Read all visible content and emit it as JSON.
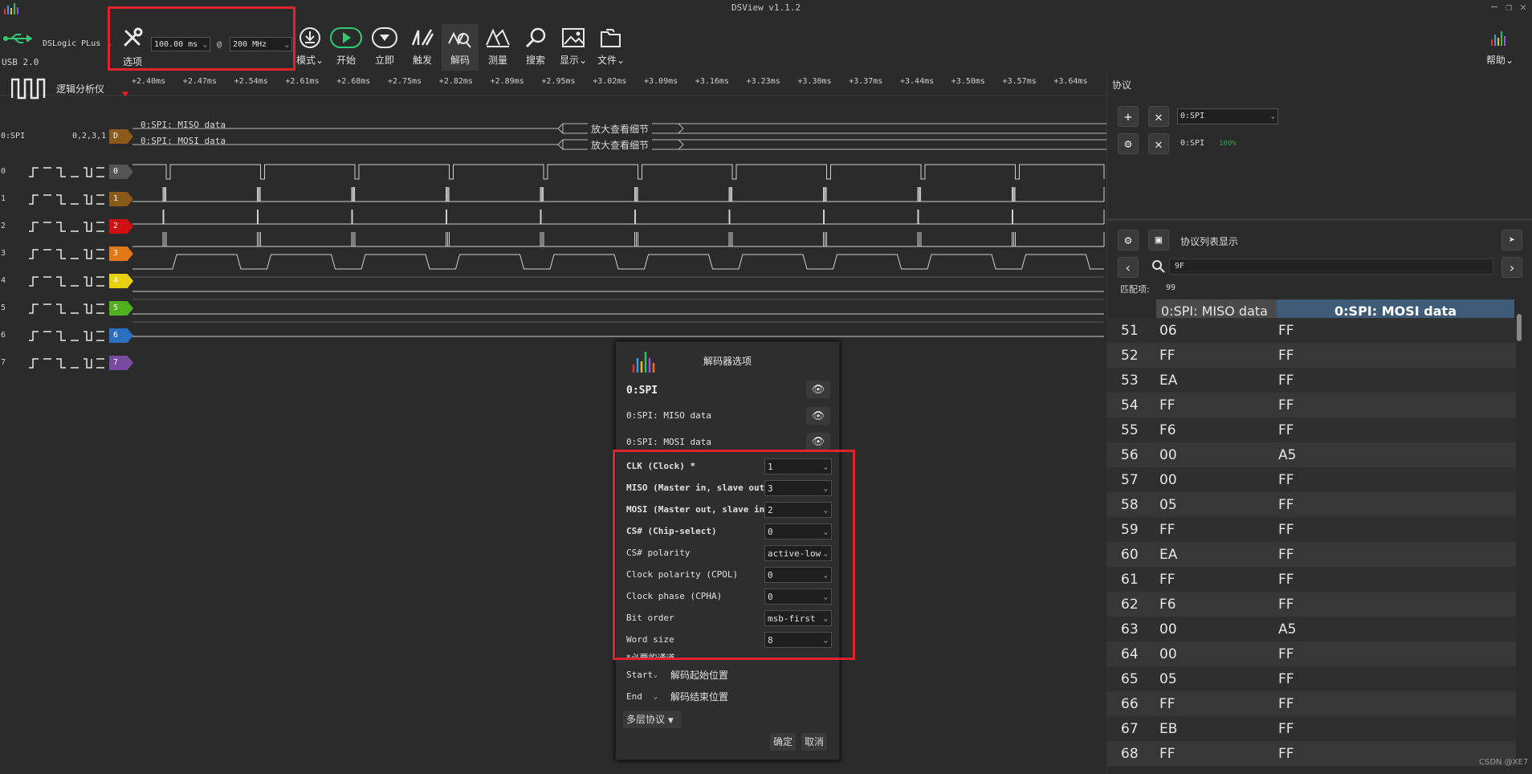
{
  "window": {
    "title": "DSView v1.1.2"
  },
  "toolbar": {
    "device": "DSLogic PLus",
    "usb": "USB 2.0",
    "options_label": "选项",
    "duration": "100.00 ms",
    "at": "@",
    "rate": "200 MHz",
    "mode_label": "模式",
    "start_label": "开始",
    "instant_label": "立即",
    "trigger_label": "触发",
    "decode_label": "解码",
    "measure_label": "测量",
    "search_label": "搜索",
    "display_label": "显示",
    "file_label": "文件",
    "help_label": "帮助"
  },
  "analyzer": {
    "label": "逻辑分析仪"
  },
  "ruler": {
    "ticks": [
      "+2.40ms",
      "+2.47ms",
      "+2.54ms",
      "+2.61ms",
      "+2.68ms",
      "+2.75ms",
      "+2.82ms",
      "+2.89ms",
      "+2.95ms",
      "+3.02ms",
      "+3.09ms",
      "+3.16ms",
      "+3.23ms",
      "+3.30ms",
      "+3.37ms",
      "+3.44ms",
      "+3.50ms",
      "+3.57ms",
      "+3.64ms"
    ]
  },
  "decoder_trace": {
    "name": "0:SPI",
    "channels": "0,2,3,1",
    "tag": "D",
    "row1": "0:SPI: MISO data",
    "row2": "0:SPI: MOSI data",
    "zoom_hint": "放大查看细节"
  },
  "channels": [
    {
      "id": "0",
      "color": "#555555"
    },
    {
      "id": "1",
      "color": "#8a5a1a"
    },
    {
      "id": "2",
      "color": "#d01010"
    },
    {
      "id": "3",
      "color": "#e07818"
    },
    {
      "id": "4",
      "color": "#e8d010"
    },
    {
      "id": "5",
      "color": "#50b020"
    },
    {
      "id": "6",
      "color": "#2a6fc0"
    },
    {
      "id": "7",
      "color": "#7a4aa0"
    }
  ],
  "protocol_panel": {
    "title": "协议",
    "decoder_select": "0:SPI",
    "decoder_name": "0:SPI",
    "progress": "100%",
    "list_title": "协议列表显示",
    "search_value": "9F",
    "match_label": "匹配项:",
    "match_count": "99",
    "col_miso": "0:SPI: MISO data",
    "col_mosi": "0:SPI: MOSI data",
    "rows": [
      {
        "n": "51",
        "miso": "06",
        "mosi": "FF"
      },
      {
        "n": "52",
        "miso": "FF",
        "mosi": "FF"
      },
      {
        "n": "53",
        "miso": "EA",
        "mosi": "FF"
      },
      {
        "n": "54",
        "miso": "FF",
        "mosi": "FF"
      },
      {
        "n": "55",
        "miso": "F6",
        "mosi": "FF"
      },
      {
        "n": "56",
        "miso": "00",
        "mosi": "A5"
      },
      {
        "n": "57",
        "miso": "00",
        "mosi": "FF"
      },
      {
        "n": "58",
        "miso": "05",
        "mosi": "FF"
      },
      {
        "n": "59",
        "miso": "FF",
        "mosi": "FF"
      },
      {
        "n": "60",
        "miso": "EA",
        "mosi": "FF"
      },
      {
        "n": "61",
        "miso": "FF",
        "mosi": "FF"
      },
      {
        "n": "62",
        "miso": "F6",
        "mosi": "FF"
      },
      {
        "n": "63",
        "miso": "00",
        "mosi": "A5"
      },
      {
        "n": "64",
        "miso": "00",
        "mosi": "FF"
      },
      {
        "n": "65",
        "miso": "05",
        "mosi": "FF"
      },
      {
        "n": "66",
        "miso": "FF",
        "mosi": "FF"
      },
      {
        "n": "67",
        "miso": "EB",
        "mosi": "FF"
      },
      {
        "n": "68",
        "miso": "FF",
        "mosi": "FF"
      }
    ]
  },
  "dialog": {
    "title": "解码器选项",
    "decoder": "0:SPI",
    "ann1": "0:SPI: MISO data",
    "ann2": "0:SPI: MOSI data",
    "opts": [
      {
        "label": "CLK (Clock) *",
        "value": "1"
      },
      {
        "label": "MISO (Master in, slave out)",
        "value": "3"
      },
      {
        "label": "MOSI (Master out, slave in)",
        "value": "2"
      },
      {
        "label": "CS# (Chip-select)",
        "value": "0"
      },
      {
        "label": "CS# polarity",
        "value": "active-low"
      },
      {
        "label": "Clock polarity (CPOL)",
        "value": "0"
      },
      {
        "label": "Clock phase (CPHA)",
        "value": "0"
      },
      {
        "label": "Bit order",
        "value": "msb-first"
      },
      {
        "label": "Word size",
        "value": "8"
      }
    ],
    "required_note": "*必要的通道",
    "start_value": "Start",
    "start_label": "解码起始位置",
    "end_value": "End",
    "end_label": "解码结束位置",
    "multi_layer": "多层协议",
    "ok": "确定",
    "cancel": "取消"
  },
  "watermark": "CSDN @XE7"
}
